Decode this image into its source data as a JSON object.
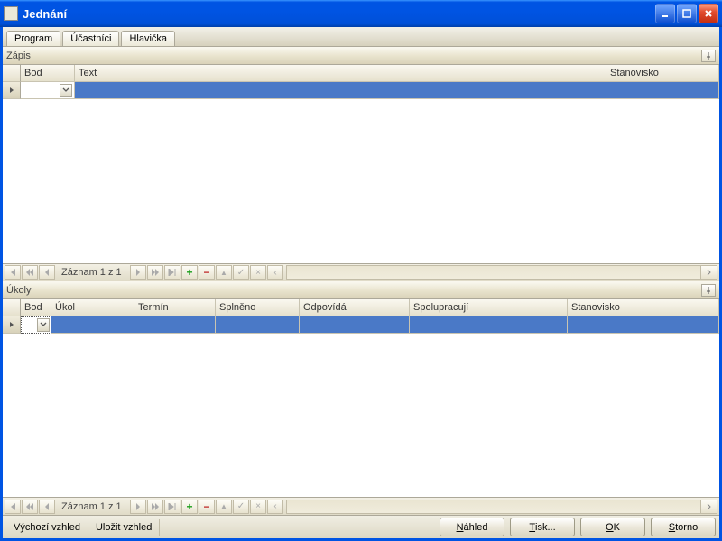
{
  "window": {
    "title": "Jednání"
  },
  "tabs": [
    {
      "label": "Program"
    },
    {
      "label": "Účastníci"
    },
    {
      "label": "Hlavička"
    }
  ],
  "panel_zapis": {
    "title": "Zápis",
    "columns": {
      "bod": "Bod",
      "text": "Text",
      "stanovisko": "Stanovisko"
    },
    "record_label": "Záznam 1 z 1"
  },
  "panel_ukoly": {
    "title": "Úkoly",
    "columns": {
      "bod": "Bod",
      "ukol": "Úkol",
      "termin": "Termín",
      "splneno": "Splněno",
      "odpovida": "Odpovídá",
      "spolupracuji": "Spolupracují",
      "stanovisko": "Stanovisko"
    },
    "record_label": "Záznam 1 z 1"
  },
  "footer": {
    "vychozi": "Výchozí vzhled",
    "ulozit": "Uložit vzhled",
    "nahled": "Náhled",
    "tisk": "Tisk...",
    "ok": "OK",
    "storno": "Storno"
  },
  "nav_icons": {
    "plus": "+",
    "minus": "−",
    "up": "▲",
    "check": "✓",
    "x": "×",
    "undo": "‹"
  }
}
